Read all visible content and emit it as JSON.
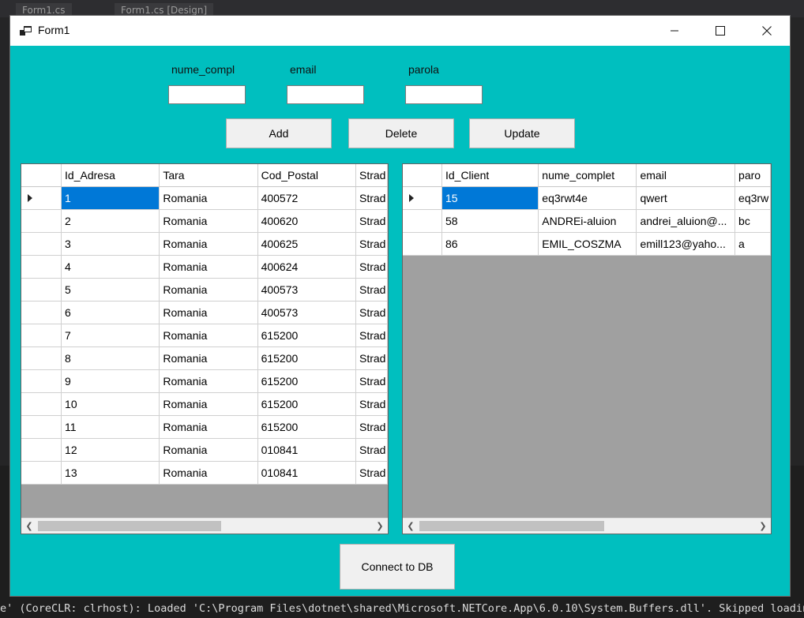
{
  "ide": {
    "tabs": [
      "Form1.cs",
      "Form1.cs [Design]"
    ],
    "output_line": "e' (CoreCLR: clrhost): Loaded 'C:\\Program Files\\dotnet\\shared\\Microsoft.NETCore.App\\6.0.10\\System.Buffers.dll'. Skipped loading"
  },
  "window": {
    "title": "Form1",
    "icons": {
      "app": "form-icon",
      "minimize": "minimize-icon",
      "maximize": "maximize-icon",
      "close": "close-icon"
    }
  },
  "fields": [
    {
      "label": "nume_compl",
      "value": ""
    },
    {
      "label": "email",
      "value": ""
    },
    {
      "label": "parola",
      "value": ""
    }
  ],
  "buttons": {
    "add": "Add",
    "delete": "Delete",
    "update": "Update",
    "connect": "Connect to DB"
  },
  "grid_adrese": {
    "columns": [
      "Id_Adresa",
      "Tara",
      "Cod_Postal",
      "Strad"
    ],
    "rows": [
      [
        "1",
        "Romania",
        "400572",
        "Strad"
      ],
      [
        "2",
        "Romania",
        "400620",
        "Strad"
      ],
      [
        "3",
        "Romania",
        "400625",
        "Strad"
      ],
      [
        "4",
        "Romania",
        "400624",
        "Strad"
      ],
      [
        "5",
        "Romania",
        "400573",
        "Strad"
      ],
      [
        "6",
        "Romania",
        "400573",
        "Strad"
      ],
      [
        "7",
        "Romania",
        "615200",
        "Strad"
      ],
      [
        "8",
        "Romania",
        "615200",
        "Strad"
      ],
      [
        "9",
        "Romania",
        "615200",
        "Strad"
      ],
      [
        "10",
        "Romania",
        "615200",
        "Strad"
      ],
      [
        "11",
        "Romania",
        "615200",
        "Strad"
      ],
      [
        "12",
        "Romania",
        "010841",
        "Strad"
      ],
      [
        "13",
        "Romania",
        "010841",
        "Strad"
      ]
    ],
    "selected_row": 0
  },
  "grid_clienti": {
    "columns": [
      "Id_Client",
      "nume_complet",
      "email",
      "paro"
    ],
    "rows": [
      [
        "15",
        "eq3rwt4e",
        "qwert",
        "eq3rw"
      ],
      [
        "58",
        "ANDREi-aluion",
        "andrei_aluion@...",
        "bc"
      ],
      [
        "86",
        "EMIL_COSZMA",
        "emill123@yaho...",
        "a"
      ]
    ],
    "selected_row": 0
  }
}
